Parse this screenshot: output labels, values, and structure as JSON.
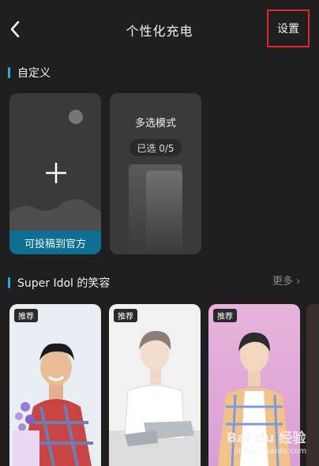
{
  "header": {
    "title": "个性化充电",
    "settings_label": "设置"
  },
  "custom_section": {
    "title": "自定义",
    "add_card": {
      "label": "可投稿到官方"
    },
    "multi_card": {
      "title": "多选模式",
      "selected_text": "已选 0/5"
    }
  },
  "idol_section": {
    "title": "Super Idol 的笑容",
    "more_label": "更多 ›",
    "cards": [
      {
        "badge": "推荐"
      },
      {
        "badge": "推荐"
      },
      {
        "badge": "推荐"
      }
    ]
  },
  "watermark": {
    "logo": "Bai du 经验",
    "url": "jingyan.baidu.com"
  },
  "colors": {
    "accent": "#2aa7e8",
    "highlight_border": "#e0262a",
    "contribute_bar": "#0e6f93"
  }
}
